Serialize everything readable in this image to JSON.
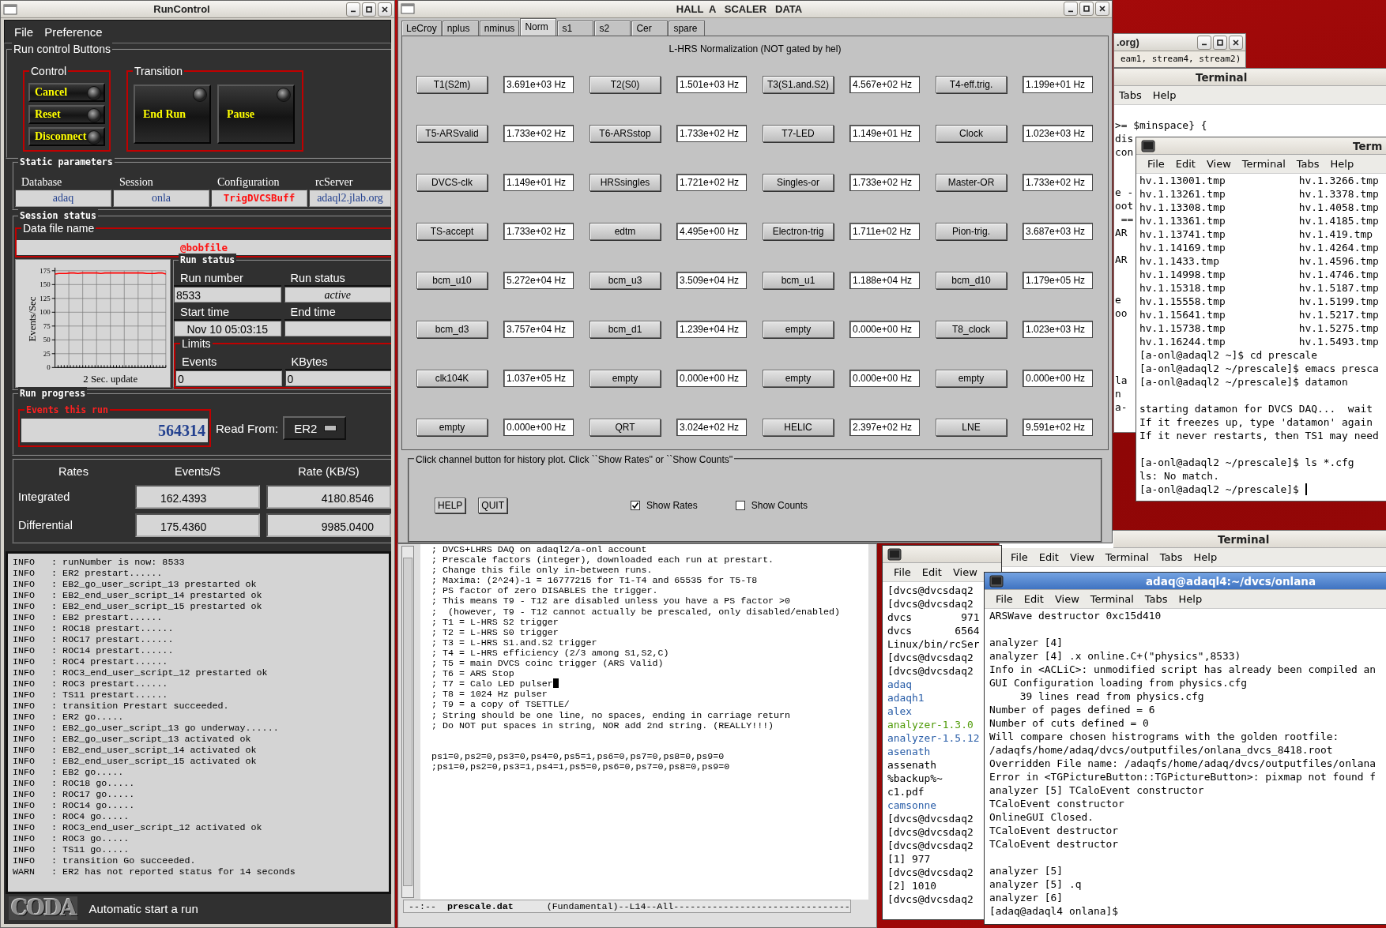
{
  "runcontrol": {
    "title": "RunControl",
    "menu": [
      "File",
      "Preference"
    ],
    "run_buttons": {
      "label": "Run control Buttons",
      "control": {
        "label": "Control",
        "buttons": [
          "Cancel",
          "Reset",
          "Disconnect"
        ]
      },
      "transition": {
        "label": "Transition",
        "buttons": [
          "End Run",
          "Pause"
        ]
      }
    },
    "static": {
      "label": "Static parameters",
      "params": [
        {
          "label": "Database",
          "value": "adaq",
          "kind": "normal"
        },
        {
          "label": "Session",
          "value": "onla",
          "kind": "normal"
        },
        {
          "label": "Configuration",
          "value": "TrigDVCSBuff",
          "kind": "alert"
        },
        {
          "label": "rcServer",
          "value": "adaql2.jlab.org",
          "kind": "normal"
        }
      ]
    },
    "session": {
      "label": "Session status",
      "data_file_label": "Data file name",
      "data_file": "@bobfile",
      "chart_data": {
        "type": "line",
        "grid": true,
        "xlabel": "2 Sec. update",
        "ylabel": "Events/Sec",
        "ylim": [
          0,
          175
        ],
        "yticks": [
          0,
          25,
          50,
          75,
          100,
          125,
          150,
          175
        ],
        "series": [
          {
            "color": "#ff0000",
            "values": [
              169,
              170,
              170,
              170,
              171,
              171,
              170,
              171,
              171,
              171,
              171,
              171,
              170,
              171,
              171,
              171,
              171,
              171,
              171,
              171,
              171,
              171,
              171,
              171,
              170,
              170,
              170,
              171,
              171,
              169
            ]
          }
        ]
      },
      "run_status": {
        "label": "Run status",
        "run_number_label": "Run number",
        "run_number": "8533",
        "status_label": "Run status",
        "status": "active",
        "start_label": "Start time",
        "start": "Nov 10 05:03:15",
        "end_label": "End time",
        "limits_label": "Limits",
        "events_label": "Events",
        "events": "0",
        "kbytes_label": "KBytes",
        "kbytes": "0"
      }
    },
    "progress": {
      "label": "Run progress",
      "events_label": "Events this run",
      "events": "564314",
      "read_from_label": "Read From:",
      "read_from": "ER2"
    },
    "rates": {
      "columns": [
        "Rates",
        "Events/S",
        "Rate (KB/S)"
      ],
      "rows": [
        {
          "name": "Integrated",
          "events": "162.4393",
          "rate": "4180.8546"
        },
        {
          "name": "Differential",
          "events": "175.4360",
          "rate": "9985.0400"
        }
      ]
    },
    "log": [
      "INFO   : runNumber is now: 8533",
      "INFO   : ER2 prestart......",
      "INFO   : EB2_go_user_script_13 prestarted ok",
      "INFO   : EB2_end_user_script_14 prestarted ok",
      "INFO   : EB2_end_user_script_15 prestarted ok",
      "INFO   : EB2 prestart......",
      "INFO   : ROC18 prestart......",
      "INFO   : ROC17 prestart......",
      "INFO   : ROC14 prestart......",
      "INFO   : ROC4 prestart......",
      "INFO   : ROC3_end_user_script_12 prestarted ok",
      "INFO   : ROC3 prestart......",
      "INFO   : TS11 prestart......",
      "INFO   : transition Prestart succeeded.",
      "INFO   : ER2 go.....",
      "INFO   : EB2_go_user_script_13 go underway......",
      "INFO   : EB2_go_user_script_13 activated ok",
      "INFO   : EB2_end_user_script_14 activated ok",
      "INFO   : EB2_end_user_script_15 activated ok",
      "INFO   : EB2 go.....",
      "INFO   : ROC18 go.....",
      "INFO   : ROC17 go.....",
      "INFO   : ROC14 go.....",
      "INFO   : ROC4 go.....",
      "INFO   : ROC3_end_user_script_12 activated ok",
      "INFO   : ROC3 go.....",
      "INFO   : TS11 go.....",
      "INFO   : transition Go succeeded.",
      "WARN   : ER2 has not reported status for 14 seconds"
    ],
    "logo": "CODA",
    "status": "Automatic start a run"
  },
  "scaler": {
    "title": "HALL  A   SCALER   DATA",
    "tabs": [
      {
        "label": "LeCroy",
        "selected": false
      },
      {
        "label": "nplus",
        "selected": false
      },
      {
        "label": "nminus",
        "selected": false
      },
      {
        "label": "Norm",
        "selected": true
      },
      {
        "label": "s1",
        "selected": false
      },
      {
        "label": "s2",
        "selected": false
      },
      {
        "label": "Cer",
        "selected": false
      },
      {
        "label": "spare",
        "selected": false
      }
    ],
    "heading": "L-HRS Normalization (NOT gated by hel)",
    "channels": [
      {
        "name": "T1(S2m)",
        "value": "3.691e+03 Hz"
      },
      {
        "name": "T2(S0)",
        "value": "1.501e+03 Hz"
      },
      {
        "name": "T3(S1.and.S2)",
        "value": "4.567e+02 Hz"
      },
      {
        "name": "T4-eff.trig.",
        "value": "1.199e+01 Hz"
      },
      {
        "name": "T5-ARSvalid",
        "value": "1.733e+02 Hz"
      },
      {
        "name": "T6-ARSstop",
        "value": "1.733e+02 Hz"
      },
      {
        "name": "T7-LED",
        "value": "1.149e+01 Hz"
      },
      {
        "name": "Clock",
        "value": "1.023e+03 Hz"
      },
      {
        "name": "DVCS-clk",
        "value": "1.149e+01 Hz"
      },
      {
        "name": "HRSsingles",
        "value": "1.721e+02 Hz"
      },
      {
        "name": "Singles-or",
        "value": "1.733e+02 Hz"
      },
      {
        "name": "Master-OR",
        "value": "1.733e+02 Hz"
      },
      {
        "name": "TS-accept",
        "value": "1.733e+02 Hz"
      },
      {
        "name": "edtm",
        "value": "4.495e+00 Hz"
      },
      {
        "name": "Electron-trig",
        "value": "1.711e+02 Hz"
      },
      {
        "name": "Pion-trig.",
        "value": "3.687e+03 Hz"
      },
      {
        "name": "bcm_u10",
        "value": "5.272e+04 Hz"
      },
      {
        "name": "bcm_u3",
        "value": "3.509e+04 Hz"
      },
      {
        "name": "bcm_u1",
        "value": "1.188e+04 Hz"
      },
      {
        "name": "bcm_d10",
        "value": "1.179e+05 Hz"
      },
      {
        "name": "bcm_d3",
        "value": "3.757e+04 Hz"
      },
      {
        "name": "bcm_d1",
        "value": "1.239e+04 Hz"
      },
      {
        "name": "empty",
        "value": "0.000e+00 Hz"
      },
      {
        "name": "T8_clock",
        "value": "1.023e+03 Hz"
      },
      {
        "name": "clk104K",
        "value": "1.037e+05 Hz"
      },
      {
        "name": "empty",
        "value": "0.000e+00 Hz"
      },
      {
        "name": "empty",
        "value": "0.000e+00 Hz"
      },
      {
        "name": "empty",
        "value": "0.000e+00 Hz"
      },
      {
        "name": "empty",
        "value": "0.000e+00 Hz"
      },
      {
        "name": "QRT",
        "value": "3.024e+02 Hz"
      },
      {
        "name": "HELIC",
        "value": "2.397e+02 Hz"
      },
      {
        "name": "LNE",
        "value": "9.591e+02 Hz"
      }
    ],
    "help_text": "Click channel button for history plot.  Click ``Show Rates'' or ``Show Counts''",
    "buttons": [
      "HELP",
      "QUIT"
    ],
    "options": [
      {
        "label": "Show Rates",
        "checked": true
      },
      {
        "label": "Show Counts",
        "checked": false
      }
    ]
  },
  "emacs": {
    "comments": [
      {
        "text": "; DVCS+LHRS DAQ on adaql2/a-onl account",
        "cursor": false
      },
      {
        "text": "; Prescale factors (integer), downloaded each run at prestart.",
        "cursor": false
      },
      {
        "text": "; Change this file only in-between runs.",
        "cursor": false
      },
      {
        "text": "; Maxima: (2^24)-1 = 16777215 for T1-T4 and 65535 for T5-T8",
        "cursor": false
      },
      {
        "text": "; PS factor of zero DISABLES the trigger.",
        "cursor": false
      },
      {
        "text": "; This means T9 - T12 are disabled unless you have a PS factor >0",
        "cursor": false
      },
      {
        "text": ";  (however, T9 - T12 cannot actually be prescaled, only disabled/enabled)",
        "cursor": false
      },
      {
        "text": "; T1 = L-HRS S2 trigger",
        "cursor": false
      },
      {
        "text": "; T2 = L-HRS S0 trigger",
        "cursor": false
      },
      {
        "text": "; T3 = L-HRS S1.and.S2 trigger",
        "cursor": false
      },
      {
        "text": "; T4 = L-HRS efficiency (2/3 among S1,S2,C)",
        "cursor": false
      },
      {
        "text": "; T5 = main DVCS coinc trigger (ARS Valid)",
        "cursor": false
      },
      {
        "text": "; T6 = ARS Stop",
        "cursor": false
      },
      {
        "text": "; T7 = Calo LED pulser",
        "cursor": true
      },
      {
        "text": "; T8 = 1024 Hz pulser",
        "cursor": false
      },
      {
        "text": "; T9 = a copy of TSETTLE/",
        "cursor": false
      },
      {
        "text": "; String should be one line, no spaces, ending in carriage return",
        "cursor": false
      },
      {
        "text": "; Do NOT put spaces in string, NOR add 2nd string. (REALLY!!!)",
        "cursor": false
      }
    ],
    "settings": [
      "ps1=0,ps2=0,ps3=0,ps4=0,ps5=1,ps6=0,ps7=0,ps8=0,ps9=0",
      ";ps1=0,ps2=0,ps3=1,ps4=1,ps5=0,ps6=0,ps7=0,ps8=0,ps9=0"
    ],
    "mode_line": "--:--  **prescale.dat**      (Fundamental)--L14--All--------------------------------"
  },
  "org_window": {
    "title": ".org)",
    "subtitle": "eam1, stream4, stream2)"
  },
  "back_terminal": {
    "title": "Terminal",
    "menu": [
      "Tabs",
      "Help"
    ],
    "text": ">= $minspace} {\ndis\ncon\n\n\ne -\noot\n ==\nAR\n\nAR\n\n\ne\noo\n\n\n\n\nla\nn\na-"
  },
  "front_terminal": {
    "title": "Term",
    "menu": [
      "File",
      "Edit",
      "View",
      "Terminal",
      "Tabs",
      "Help"
    ],
    "text": "hv.1.13001.tmp            hv.1.3266.tmp\nhv.1.13261.tmp            hv.1.3378.tmp\nhv.1.13308.tmp            hv.1.4058.tmp\nhv.1.13361.tmp            hv.1.4185.tmp\nhv.1.13741.tmp            hv.1.419.tmp\nhv.1.14169.tmp            hv.1.4264.tmp\nhv.1.1433.tmp             hv.1.4596.tmp\nhv.1.14998.tmp            hv.1.4746.tmp\nhv.1.15318.tmp            hv.1.5187.tmp\nhv.1.15558.tmp            hv.1.5199.tmp\nhv.1.15641.tmp            hv.1.5217.tmp\nhv.1.15738.tmp            hv.1.5275.tmp\nhv.1.16244.tmp            hv.1.5493.tmp\n[a-onl@adaql2 ~]$ cd prescale\n[a-onl@adaql2 ~/prescale]$ emacs presca\n[a-onl@adaql2 ~/prescale]$ datamon\n\nstarting datamon for DVCS DAQ...  wait\nIf it freezes up, type 'datamon' again\nIf it never restarts, then TS1 may need\n\n[a-onl@adaql2 ~/prescale]$ ls *.cfg\nls: No match.\n[a-onl@adaql2 ~/prescale]$"
  },
  "bottom_terminal": {
    "title": "Terminal",
    "menu": [
      "File",
      "Edit",
      "View",
      "Terminal",
      "Tabs",
      "Help"
    ]
  },
  "dvcs_terminal": {
    "menu": [
      "File",
      "Edit",
      "View"
    ],
    "lines": [
      {
        "text": "[dvcs@dvcsdaq2",
        "color": "#000000"
      },
      {
        "text": "[dvcs@dvcsdaq2",
        "color": "#000000"
      },
      {
        "text": "dvcs        971",
        "color": "#000000"
      },
      {
        "text": "dvcs       6564",
        "color": "#000000"
      },
      {
        "text": "Linux/bin/rcSer",
        "color": "#000000"
      },
      {
        "text": "[dvcs@dvcsdaq2",
        "color": "#000000"
      },
      {
        "text": "[dvcs@dvcsdaq2",
        "color": "#000000"
      },
      {
        "text": "adaq",
        "color": "#2a5ea8"
      },
      {
        "text": "adaqh1",
        "color": "#2a5ea8"
      },
      {
        "text": "alex",
        "color": "#2a5ea8"
      },
      {
        "text": "analyzer-1.3.0",
        "color": "#4e9a06"
      },
      {
        "text": "analyzer-1.5.12",
        "color": "#2a5ea8"
      },
      {
        "text": "asenath",
        "color": "#2a5ea8"
      },
      {
        "text": "assenath",
        "color": "#000000"
      },
      {
        "text": "%backup%~",
        "color": "#000000"
      },
      {
        "text": "c1.pdf",
        "color": "#000000"
      },
      {
        "text": "camsonne",
        "color": "#2a5ea8"
      },
      {
        "text": "[dvcs@dvcsdaq2",
        "color": "#000000"
      },
      {
        "text": "[dvcs@dvcsdaq2",
        "color": "#000000"
      },
      {
        "text": "[dvcs@dvcsdaq2",
        "color": "#000000"
      },
      {
        "text": "[1] 977",
        "color": "#000000"
      },
      {
        "text": "[dvcs@dvcsdaq2",
        "color": "#000000"
      },
      {
        "text": "[2] 1010",
        "color": "#000000"
      },
      {
        "text": "[dvcs@dvcsdaq2",
        "color": "#000000"
      }
    ]
  },
  "adaq_terminal": {
    "title": "adaq@adaql4:~/dvcs/onlana",
    "menu": [
      "File",
      "Edit",
      "View",
      "Terminal",
      "Tabs",
      "Help"
    ],
    "text": "ARSWave destructor 0xc15d410\n\nanalyzer [4]\nanalyzer [4] .x online.C+(\"physics\",8533)\nInfo in <ACLiC>: unmodified script has already been compiled an\nGUI Configuration loading from physics.cfg\n     39 lines read from physics.cfg\nNumber of pages defined = 6\nNumber of cuts defined = 0\nWill compare chosen histrograms with the golden rootfile:\n/adaqfs/home/adaq/dvcs/outputfiles/onlana_dvcs_8418.root\nOverridden File name: /adaqfs/home/adaq/dvcs/outputfiles/onlana\nError in <TGPictureButton::TGPictureButton>: pixmap not found f\nanalyzer [5] TCaloEvent constructor\nTCaloEvent constructor\nOnlineGUI Closed.\nTCaloEvent destructor\nTCaloEvent destructor\n\nanalyzer [5]\nanalyzer [5] .q\nanalyzer [6]\n[adaq@adaql4 onlana]$"
  }
}
